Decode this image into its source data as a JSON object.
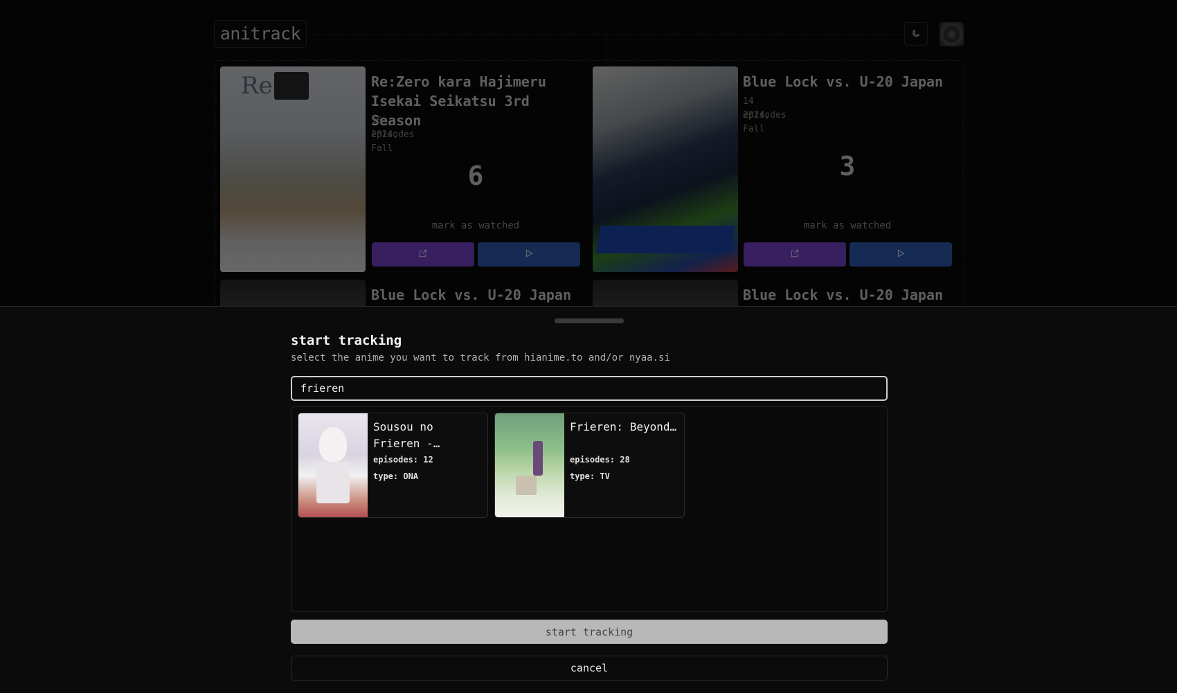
{
  "app": {
    "logo": "anitrack"
  },
  "tracked": [
    {
      "title": "Re:Zero kara Hajimeru Isekai Seikatsu 3rd Season",
      "episodes": "16 episodes",
      "season": "2024, Fall",
      "count": "6",
      "mark_label": "mark as watched"
    },
    {
      "title": "Blue Lock vs. U-20 Japan",
      "episodes": "14 episodes",
      "season": "2024, Fall",
      "count": "3",
      "mark_label": "mark as watched"
    },
    {
      "title": "Blue Lock vs. U-20 Japan"
    },
    {
      "title": "Blue Lock vs. U-20 Japan"
    }
  ],
  "drawer": {
    "title": "start tracking",
    "subtitle": "select the anime you want to track from hianime.to and/or nyaa.si",
    "search": {
      "value": "frieren"
    },
    "results": [
      {
        "title": "Sousou no Frieren -…",
        "episodes": "episodes: 12",
        "type": "type: ONA"
      },
      {
        "title": "Frieren: Beyond…",
        "episodes": "episodes: 28",
        "type": "type: TV"
      }
    ],
    "start_label": "start tracking",
    "cancel_label": "cancel"
  },
  "icons": {
    "theme": "moon-icon",
    "open": "external-link-icon",
    "play": "play-icon"
  },
  "colors": {
    "open_button": "#7b46d4",
    "play_button": "#2f5fb8",
    "start_button": "#b8b8b8"
  }
}
